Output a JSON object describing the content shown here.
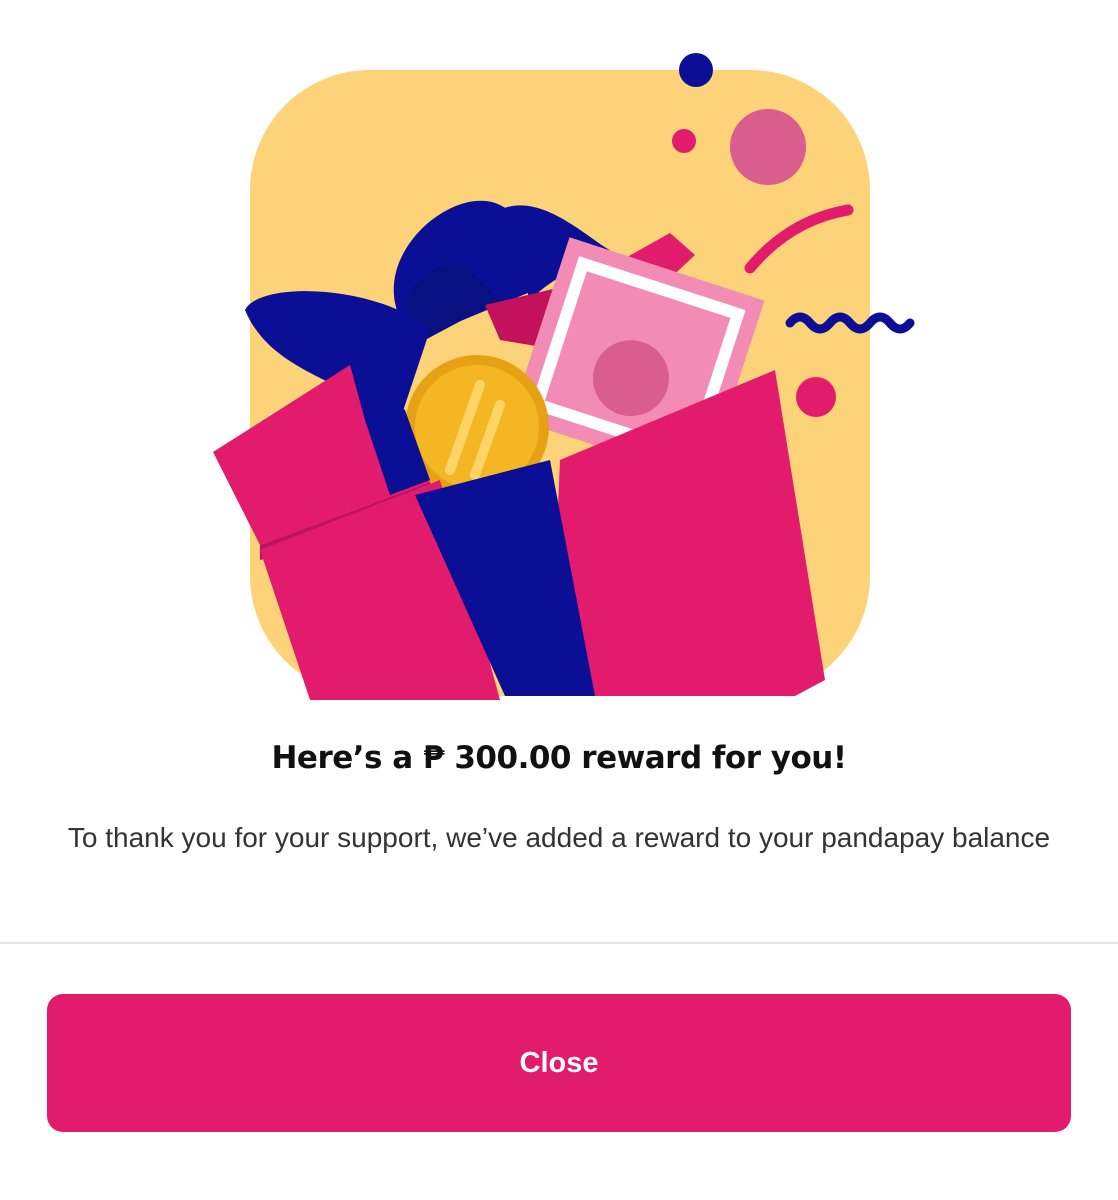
{
  "dialog": {
    "title": "Here’s a ₱ 300.00 reward for you!",
    "message": "To thank you for your support, we’ve added a reward to your pandapay balance",
    "close_label": "Close"
  },
  "illustration": {
    "icon": "gift-box-reward-illustration"
  },
  "colors": {
    "brand_pink": "#e31b6d",
    "ribbon_blue": "#0a0f96",
    "background_yellow": "#fdd37a",
    "coin_gold": "#f5b624"
  }
}
